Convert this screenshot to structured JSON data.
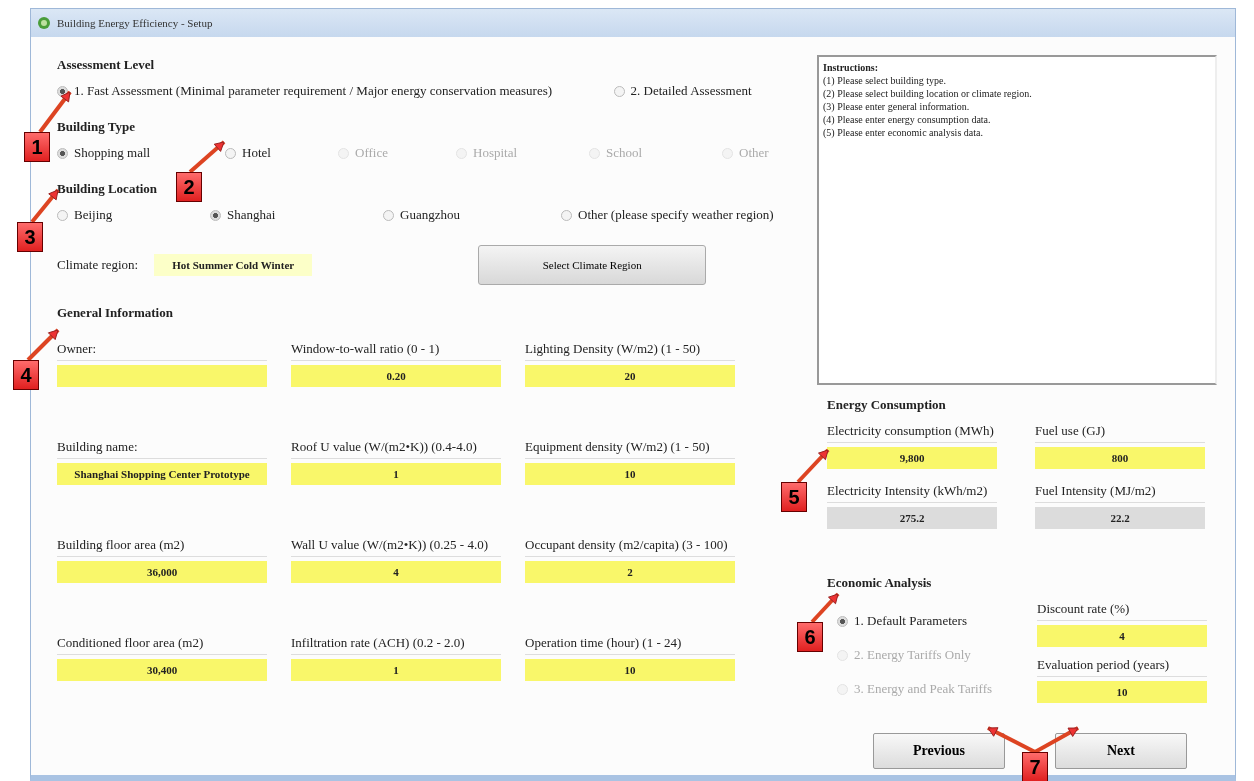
{
  "window": {
    "title": "Building Energy Efficiency - Setup"
  },
  "assessment_level": {
    "heading": "Assessment Level",
    "options": [
      {
        "label": "1. Fast Assessment (Minimal parameter requirement / Major energy conservation measures)",
        "selected": true,
        "disabled": false
      },
      {
        "label": "2. Detailed Assessment",
        "selected": false,
        "disabled": false
      }
    ]
  },
  "building_type": {
    "heading": "Building Type",
    "options": [
      {
        "label": "Shopping mall",
        "selected": true,
        "disabled": false
      },
      {
        "label": "Hotel",
        "selected": false,
        "disabled": false
      },
      {
        "label": "Office",
        "selected": false,
        "disabled": true
      },
      {
        "label": "Hospital",
        "selected": false,
        "disabled": true
      },
      {
        "label": "School",
        "selected": false,
        "disabled": true
      },
      {
        "label": "Other",
        "selected": false,
        "disabled": true
      }
    ]
  },
  "building_location": {
    "heading": "Building Location",
    "options": [
      {
        "label": "Beijing",
        "selected": false,
        "disabled": false
      },
      {
        "label": "Shanghai",
        "selected": true,
        "disabled": false
      },
      {
        "label": "Guangzhou",
        "selected": false,
        "disabled": false
      },
      {
        "label": "Other (please specify weather region)",
        "selected": false,
        "disabled": false
      }
    ],
    "climate_label": "Climate region:",
    "climate_value": "Hot Summer Cold Winter",
    "select_button": "Select Climate Region"
  },
  "general_information": {
    "heading": "General Information",
    "fields": [
      {
        "label": "Owner:"
      },
      {
        "label": "Window-to-wall ratio (0 - 1)",
        "value": "0.20"
      },
      {
        "label": "Lighting Density (W/m2) (1 - 50)",
        "value": "20"
      },
      {
        "label": "Building name:",
        "value": "Shanghai Shopping Center Prototype"
      },
      {
        "label": "Roof U value (W/(m2•K))  (0.4-4.0)",
        "value": "1"
      },
      {
        "label": "Equipment density (W/m2) (1 - 50)",
        "value": "10"
      },
      {
        "label": "Building floor area (m2)",
        "value": "36,000"
      },
      {
        "label": "Wall U value (W/(m2•K)) (0.25 - 4.0)",
        "value": "4"
      },
      {
        "label": "Occupant density (m2/capita) (3 - 100)",
        "value": "2"
      },
      {
        "label": "Conditioned floor area (m2)",
        "value": "30,400"
      },
      {
        "label": "Infiltration rate (ACH)  (0.2 - 2.0)",
        "value": "1"
      },
      {
        "label": "Operation time (hour) (1 - 24)",
        "value": "10"
      }
    ]
  },
  "instructions": {
    "heading": "Instructions:",
    "lines": [
      "(1) Please select building type.",
      "(2) Please select building location or climate region.",
      "(3) Please enter general information.",
      "(4) Please enter energy consumption data.",
      "(5) Please enter economic analysis data."
    ]
  },
  "energy_consumption": {
    "heading": "Energy Consumption",
    "fields": [
      {
        "label": "Electricity consumption (MWh)",
        "value": "9,800",
        "kind": "input"
      },
      {
        "label": "Fuel use (GJ)",
        "value": "800",
        "kind": "input"
      },
      {
        "label": "Electricity Intensity (kWh/m2)",
        "value": "275.2",
        "kind": "readonly"
      },
      {
        "label": "Fuel Intensity (MJ/m2)",
        "value": "22.2",
        "kind": "readonly"
      }
    ]
  },
  "economic_analysis": {
    "heading": "Economic Analysis",
    "options": [
      {
        "label": "1. Default Parameters",
        "selected": true,
        "disabled": false
      },
      {
        "label": "2. Energy Tariffs Only",
        "selected": false,
        "disabled": true
      },
      {
        "label": "3. Energy and Peak Tariffs",
        "selected": false,
        "disabled": true
      }
    ],
    "fields": [
      {
        "label": "Discount rate (%)",
        "value": "4"
      },
      {
        "label": "Evaluation period (years)",
        "value": "10"
      }
    ]
  },
  "buttons": [
    "Previous",
    "Next"
  ],
  "callouts": [
    {
      "label": "1"
    },
    {
      "label": "2"
    },
    {
      "label": "3"
    },
    {
      "label": "4"
    },
    {
      "label": "5"
    },
    {
      "label": "6"
    },
    {
      "label": "7"
    }
  ]
}
